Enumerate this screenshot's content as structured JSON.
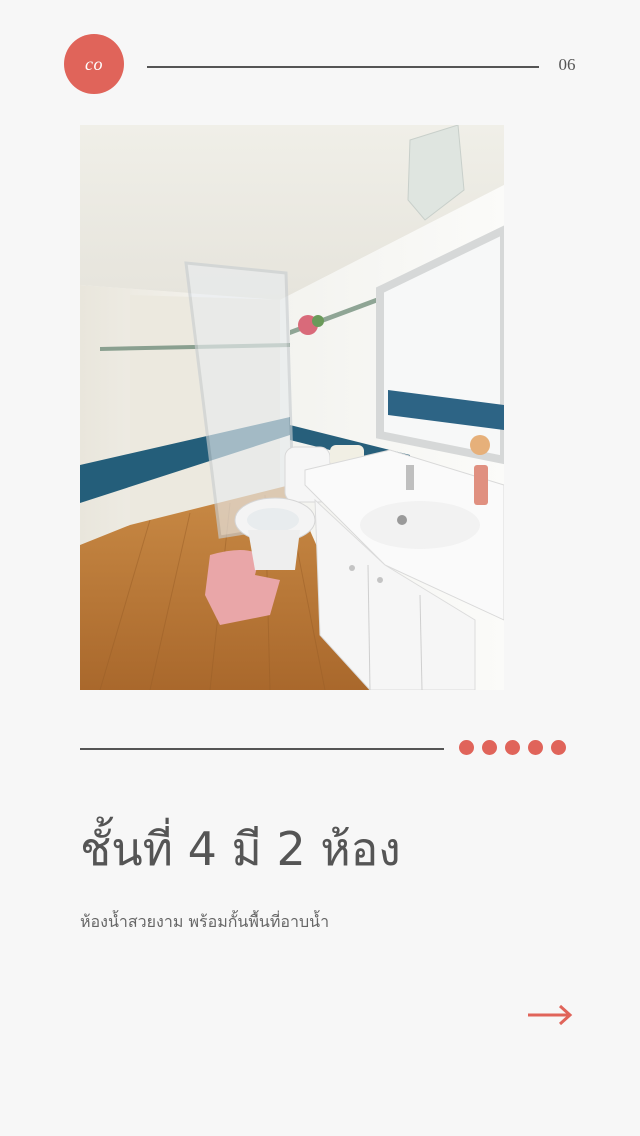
{
  "header": {
    "logo_text": "co",
    "page_number": "06"
  },
  "photo": {
    "subject": "bathroom",
    "icon": "bathroom-photo"
  },
  "pagination": {
    "dot_count": 5,
    "accent_color": "#e0645a"
  },
  "content": {
    "heading": "ชั้นที่ 4 มี 2 ห้อง",
    "subtitle": "ห้องน้ำสวยงาม พร้อมกั้นพื้นที่อาบน้ำ"
  },
  "navigation": {
    "next_icon": "arrow-right-icon"
  }
}
